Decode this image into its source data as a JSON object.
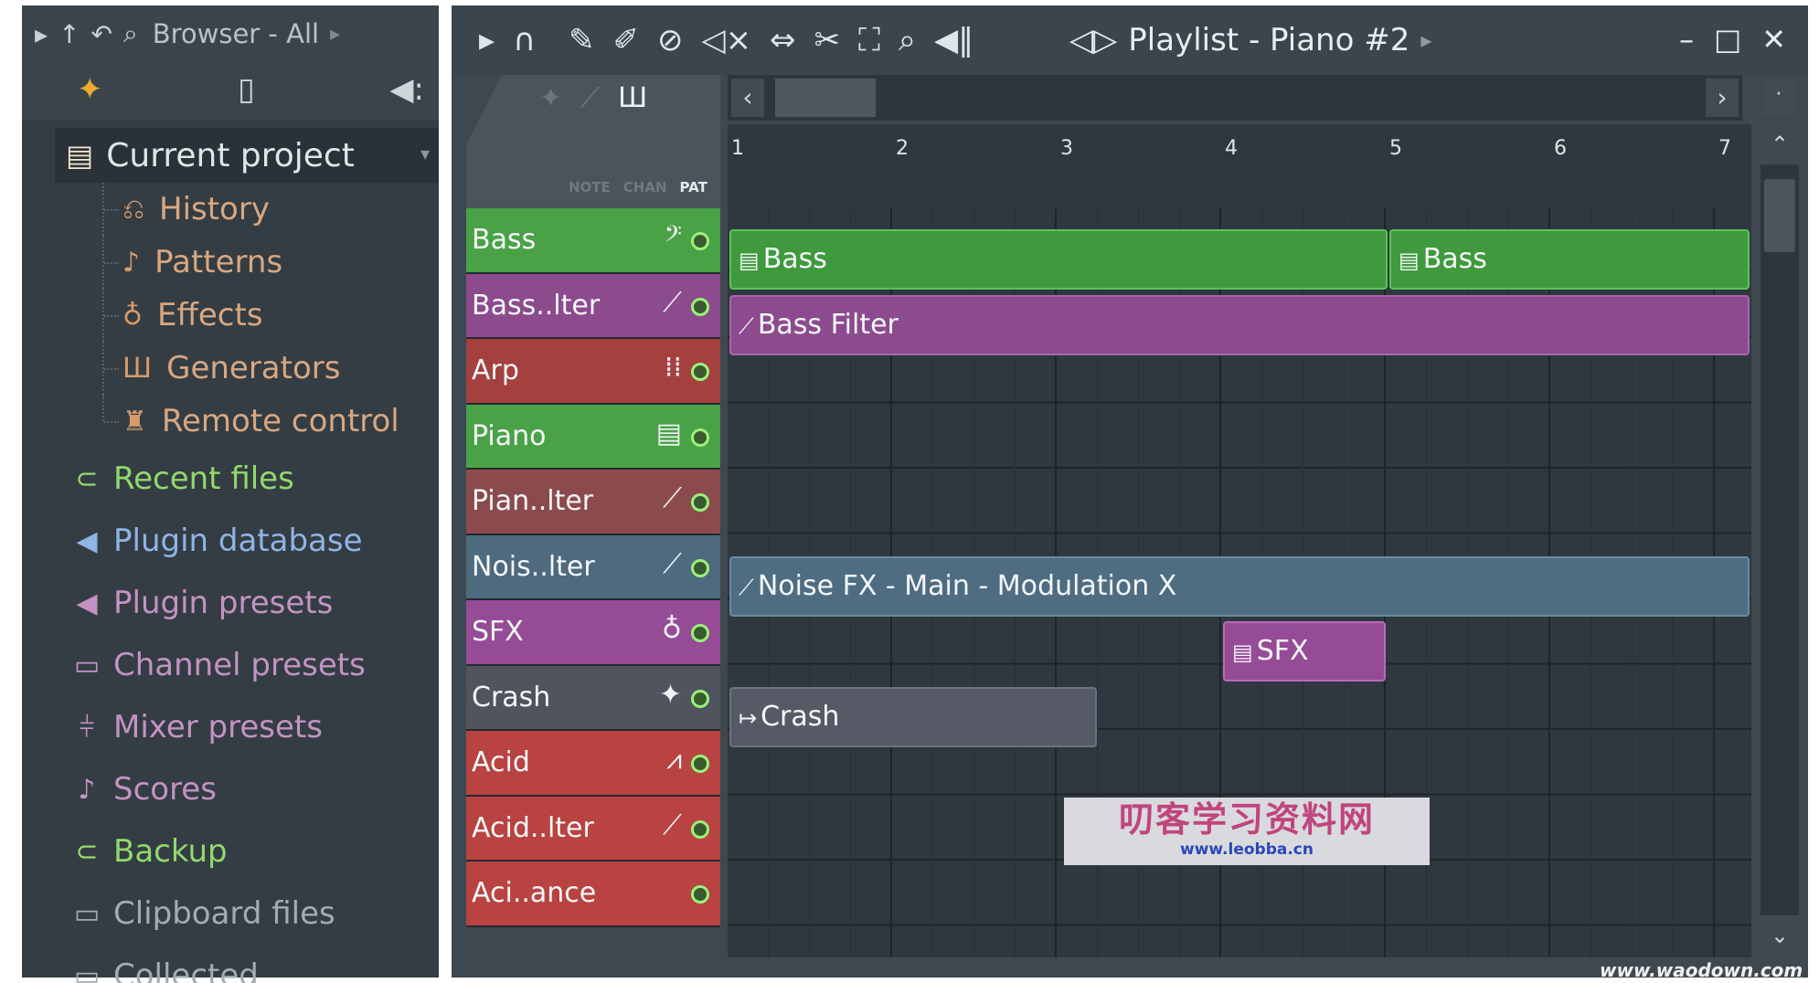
{
  "browser": {
    "title": "Browser - All",
    "current_project": "Current project",
    "sub_items": [
      {
        "label": "History",
        "icon": "history-icon"
      },
      {
        "label": "Patterns",
        "icon": "note-icon"
      },
      {
        "label": "Effects",
        "icon": "effect-icon"
      },
      {
        "label": "Generators",
        "icon": "generator-icon"
      },
      {
        "label": "Remote control",
        "icon": "remote-icon"
      }
    ],
    "items": [
      {
        "label": "Recent files",
        "icon": "folder-link-icon",
        "color": "#93d86e"
      },
      {
        "label": "Plugin database",
        "icon": "speaker-icon",
        "color": "#8fb4e6"
      },
      {
        "label": "Plugin presets",
        "icon": "speaker-icon",
        "color": "#c393c4"
      },
      {
        "label": "Channel presets",
        "icon": "channel-icon",
        "color": "#c393c4"
      },
      {
        "label": "Mixer presets",
        "icon": "mixer-icon",
        "color": "#c393c4"
      },
      {
        "label": "Scores",
        "icon": "note-icon",
        "color": "#c393c4"
      },
      {
        "label": "Backup",
        "icon": "folder-link-icon",
        "color": "#93d86e"
      },
      {
        "label": "Clipboard files",
        "icon": "folder-icon",
        "color": "#a2adb2"
      },
      {
        "label": "Collected",
        "icon": "folder-icon",
        "color": "#a2adb2"
      }
    ]
  },
  "playlist": {
    "title": "Playlist - Piano #2",
    "header_labels": {
      "note": "NOTE",
      "chan": "CHAN",
      "pat": "PAT"
    },
    "bars": [
      "1",
      "2",
      "3",
      "4",
      "5",
      "6",
      "7"
    ],
    "tracks": [
      {
        "name": "Bass",
        "color": "#4aa247",
        "icon": "bass-clef-icon"
      },
      {
        "name": "Bass..lter",
        "color": "#8b4b8d",
        "icon": "automation-icon"
      },
      {
        "name": "Arp",
        "color": "#a4403e",
        "icon": "arp-icon"
      },
      {
        "name": "Piano",
        "color": "#4aa247",
        "icon": "pattern-icon"
      },
      {
        "name": "Pian..lter",
        "color": "#8b4b4d",
        "icon": "automation-icon"
      },
      {
        "name": "Nois..lter",
        "color": "#4d6a7e",
        "icon": "automation-icon"
      },
      {
        "name": "SFX",
        "color": "#964b97",
        "icon": "effect-icon"
      },
      {
        "name": "Crash",
        "color": "#4f545e",
        "icon": "audio-icon"
      },
      {
        "name": "Acid",
        "color": "#b84341",
        "icon": "acid-icon"
      },
      {
        "name": "Acid..lter",
        "color": "#b84341",
        "icon": "automation-icon"
      },
      {
        "name": "Aci..ance",
        "color": "#b84341",
        "icon": ""
      }
    ],
    "clips": {
      "bass1": "Bass",
      "bass2": "Bass",
      "bass_filter": "Bass Filter",
      "noise": "Noise FX - Main - Modulation X",
      "sfx": "SFX",
      "crash": "Crash"
    }
  },
  "watermark": {
    "line1": "叨客学习资料网",
    "line2": "www.leobba.cn",
    "corner": "www.waodown.com"
  }
}
